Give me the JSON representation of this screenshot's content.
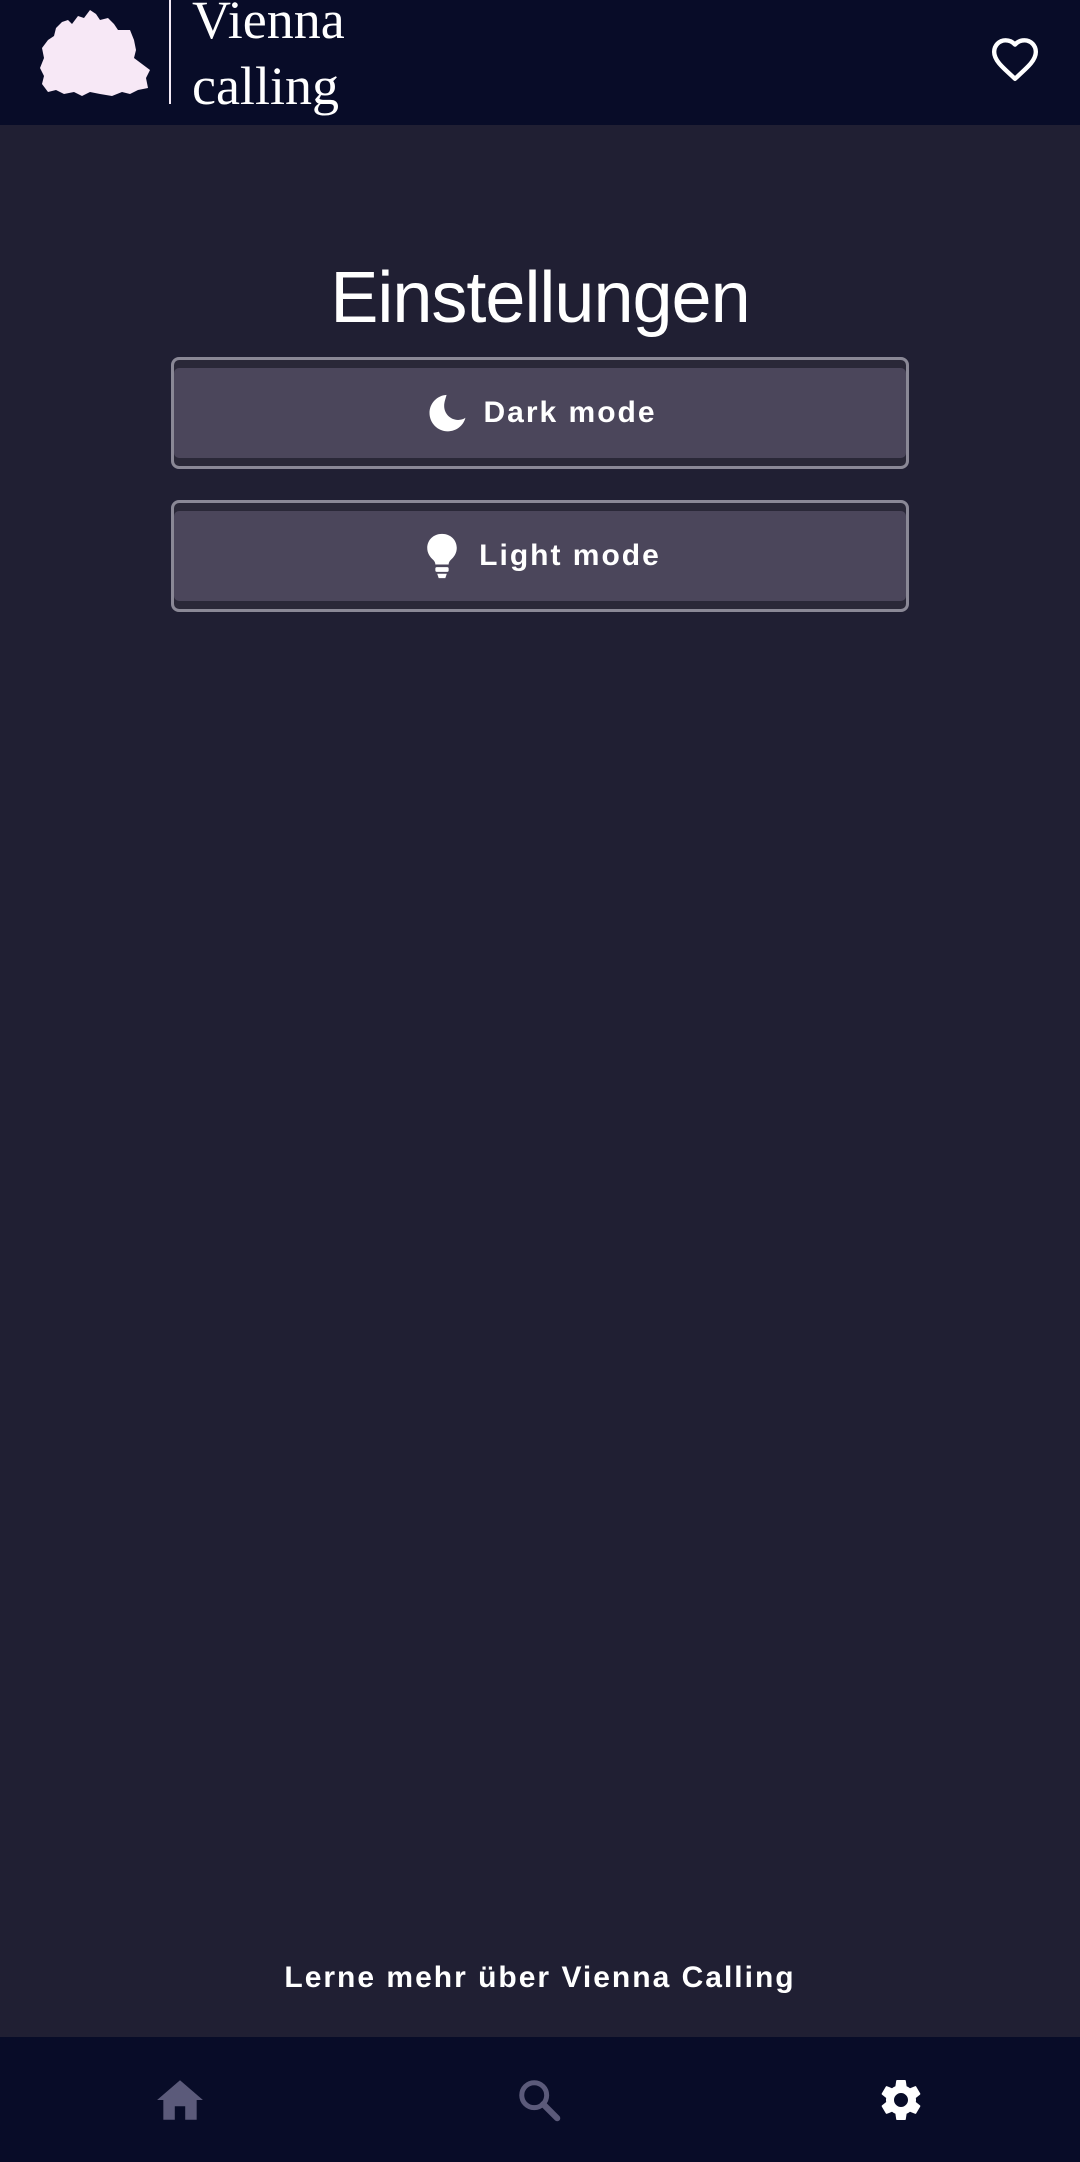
{
  "header": {
    "logo_line_1": "Vienna",
    "logo_line_2": "calling",
    "favorites_icon": "heart-outline-icon"
  },
  "main": {
    "title": "Einstellungen",
    "buttons": [
      {
        "label": "Dark mode",
        "icon": "moon-icon"
      },
      {
        "label": "Light mode",
        "icon": "lightbulb-icon"
      }
    ],
    "learn_more": "Lerne mehr über Vienna Calling"
  },
  "bottom_nav": {
    "items": [
      {
        "name": "home",
        "icon": "home-icon",
        "active": false
      },
      {
        "name": "search",
        "icon": "search-icon",
        "active": false
      },
      {
        "name": "settings",
        "icon": "gear-icon",
        "active": true
      }
    ]
  },
  "colors": {
    "header_bg": "#080c28",
    "page_bg": "#201f33",
    "button_bg": "#4b465b",
    "button_border": "#8a8896",
    "nav_inactive": "#5b5a7a",
    "nav_active": "#ffffff",
    "logo_fill": "#f7e8f6"
  }
}
